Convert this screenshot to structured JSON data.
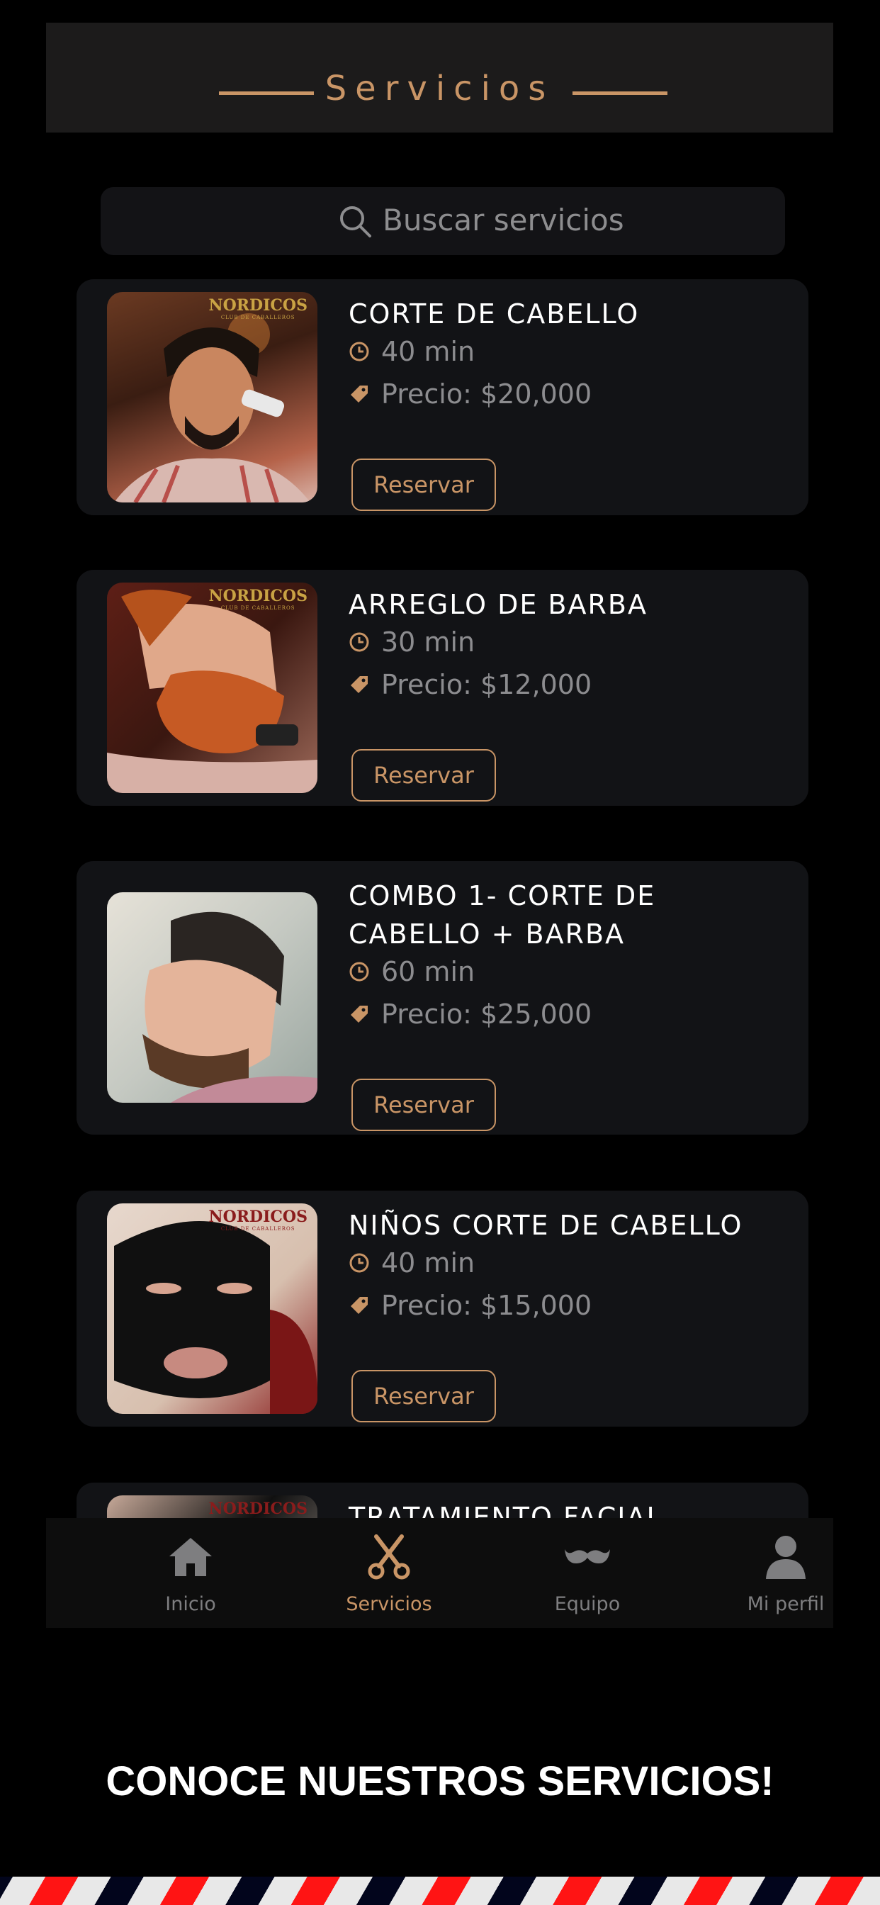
{
  "header": {
    "title": "Servicios"
  },
  "search": {
    "placeholder": "Buscar servicios"
  },
  "services": [
    {
      "name": "CORTE DE CABELLO",
      "duration": "40 min",
      "price": "Precio: $20,000",
      "button": "Reservar"
    },
    {
      "name": "ARREGLO DE BARBA",
      "duration": "30 min",
      "price": "Precio: $12,000",
      "button": "Reservar"
    },
    {
      "name": "COMBO 1- CORTE DE CABELLO + BARBA",
      "duration": "60 min",
      "price": "Precio: $25,000",
      "button": "Reservar"
    },
    {
      "name": "NIÑOS CORTE DE CABELLO",
      "duration": "40 min",
      "price": "Precio: $15,000",
      "button": "Reservar"
    },
    {
      "name": "TRATAMIENTO FACIAL BLACK"
    }
  ],
  "photo_logo": {
    "text": "NORDICOS",
    "sub": "CLUB DE CABALLEROS"
  },
  "tabs": [
    {
      "label": "Inicio",
      "icon": "home-icon"
    },
    {
      "label": "Servicios",
      "icon": "scissors-icon",
      "active": true
    },
    {
      "label": "Equipo",
      "icon": "mustache-icon"
    },
    {
      "label": "Mi perfil",
      "icon": "user-icon"
    }
  ],
  "promo": {
    "text": "CONOCE NUESTROS SERVICIOS!"
  },
  "colors": {
    "accent": "#c99566",
    "background": "#000000",
    "card": "#121316",
    "muted": "#8c8c8f"
  }
}
